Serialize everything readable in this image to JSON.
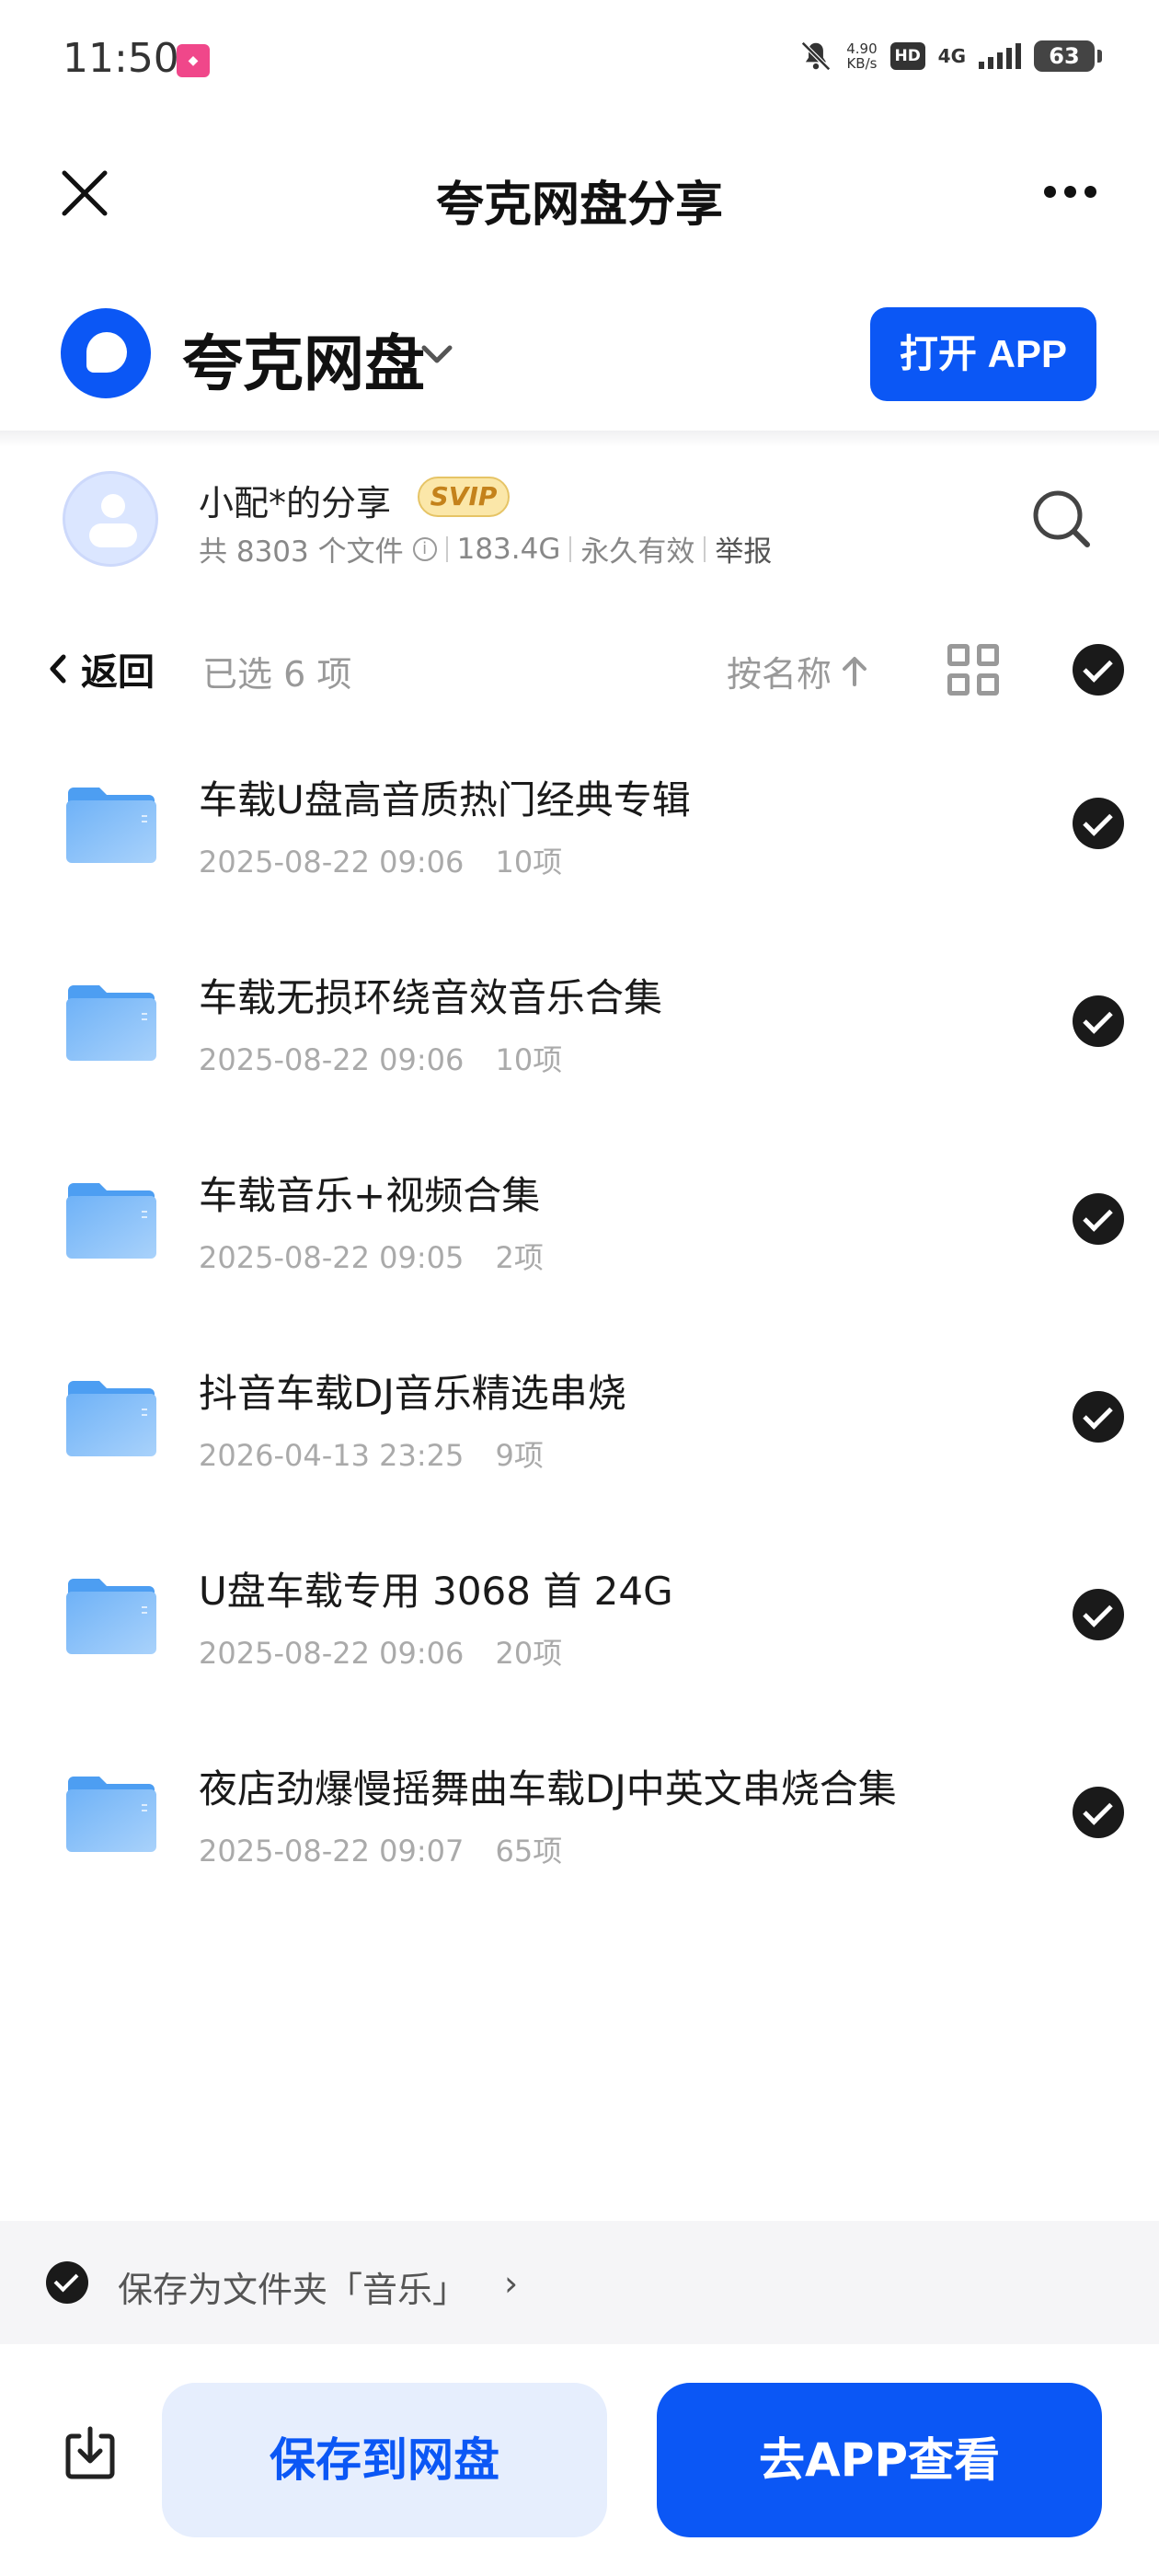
{
  "status_bar": {
    "time": "11:50",
    "net_speed_value": "4.90",
    "net_speed_unit": "KB/s",
    "hd_label": "HD",
    "network_label": "4G",
    "battery": "63"
  },
  "nav": {
    "title": "夸克网盘分享"
  },
  "brand": {
    "name": "夸克网盘",
    "open_app_label": "打开 APP",
    "accent_color": "#0b57f5"
  },
  "sharer": {
    "name": "小配*的分享",
    "badge": "SVIP",
    "file_count": "共 8303 个文件",
    "size": "183.4G",
    "validity": "永久有效",
    "report": "举报"
  },
  "toolbar": {
    "back_label": "返回",
    "selected_label": "已选 6 项",
    "sort_label": "按名称"
  },
  "files": [
    {
      "name": "车载U盘高音质热门经典专辑",
      "date": "2025-08-22 09:06",
      "count": "10项"
    },
    {
      "name": "车载无损环绕音效音乐合集",
      "date": "2025-08-22 09:06",
      "count": "10项"
    },
    {
      "name": "车载音乐+视频合集",
      "date": "2025-08-22 09:05",
      "count": "2项"
    },
    {
      "name": "抖音车载DJ音乐精选串烧",
      "date": "2026-04-13 23:25",
      "count": "9项"
    },
    {
      "name": "U盘车载专用 3068 首 24G",
      "date": "2025-08-22 09:06",
      "count": "20项"
    },
    {
      "name": "夜店劲爆慢摇舞曲车载DJ中英文串烧合集",
      "date": "2025-08-22 09:07",
      "count": "65项"
    }
  ],
  "save_folder": {
    "text": "保存为文件夹「音乐」",
    "arrow": "›"
  },
  "bottom": {
    "save_label": "保存到网盘",
    "goto_app_label": "去APP查看"
  }
}
